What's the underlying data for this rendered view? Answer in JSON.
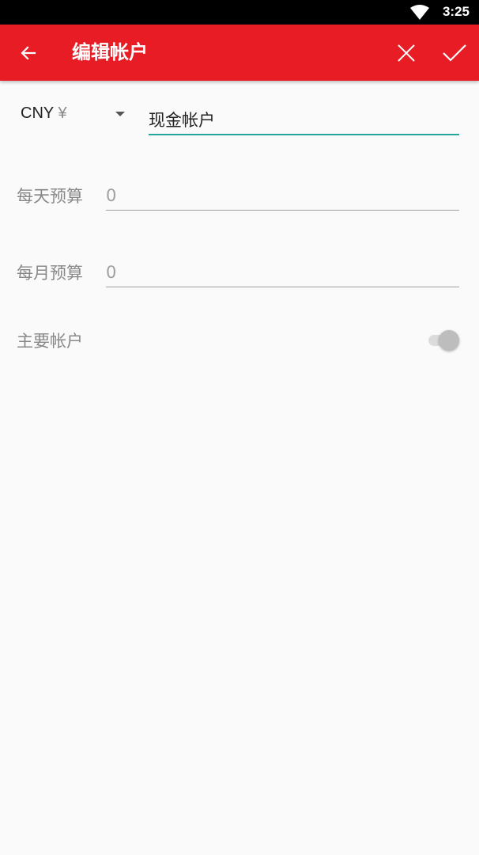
{
  "status_bar": {
    "time": "3:25",
    "icons": [
      "wifi-icon"
    ]
  },
  "app_bar": {
    "title": "编辑帐户",
    "background_color": "#e71c24",
    "icons": [
      "back-arrow-icon",
      "close-icon",
      "check-icon"
    ]
  },
  "form": {
    "currency": {
      "code": "CNY",
      "symbol": "¥"
    },
    "account_name": {
      "value": "现金帐户"
    },
    "daily_budget": {
      "label": "每天预算",
      "placeholder": "0"
    },
    "monthly_budget": {
      "label": "每月预算",
      "placeholder": "0"
    },
    "primary_account": {
      "label": "主要帐户",
      "enabled": false
    }
  },
  "colors": {
    "accent": "#26a69a",
    "background": "#fafafa"
  }
}
